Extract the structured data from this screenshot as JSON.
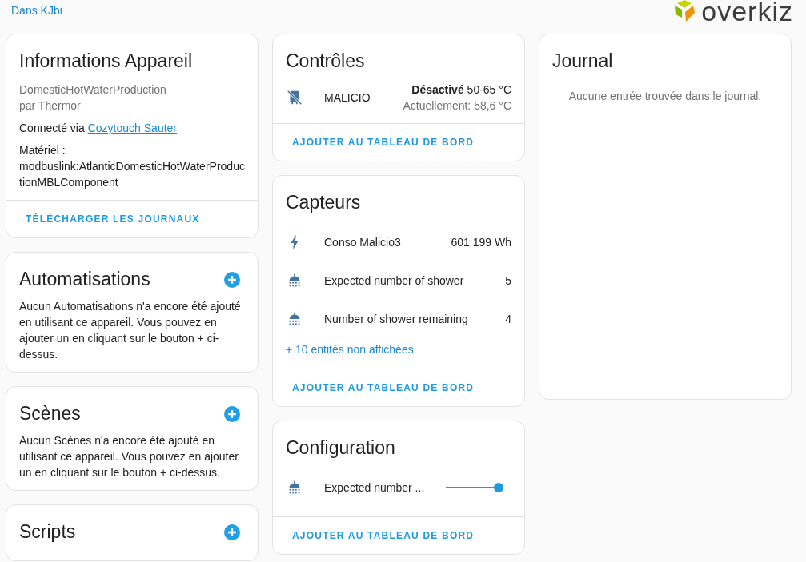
{
  "breadcrumb": "Dans KJbi",
  "logo": {
    "text": "overkiz"
  },
  "info": {
    "title": "Informations Appareil",
    "model": "DomesticHotWaterProduction",
    "manufacturer": "par Thermor",
    "connected_prefix": "Connecté via",
    "connected_link": "Cozytouch Sauter",
    "hardware_label": "Matériel :",
    "hardware_value": "modbuslink:AtlanticDomesticHotWaterProductionMBLComponent",
    "action": "TÉLÉCHARGER LES JOURNAUX"
  },
  "related": [
    {
      "title": "Automatisations",
      "text": "Aucun Automatisations n'a encore été ajouté en utilisant ce appareil. Vous pouvez en ajouter un en cliquant sur le bouton + ci-dessus."
    },
    {
      "title": "Scènes",
      "text": "Aucun Scènes n'a encore été ajouté en utilisant ce appareil. Vous pouvez en ajouter un en cliquant sur le bouton + ci-dessus."
    },
    {
      "title": "Scripts"
    }
  ],
  "controls": {
    "title": "Contrôles",
    "rows": [
      {
        "kind": "heater",
        "name": "MALICIO",
        "state": "Désactivé",
        "range": "50-65 °C",
        "current": "Actuellement: 58,6 °C"
      }
    ],
    "action": "AJOUTER AU TABLEAU DE BORD"
  },
  "sensors": {
    "title": "Capteurs",
    "rows": [
      {
        "kind": "bolt",
        "name": "Conso Malicio3",
        "value": "601 199 Wh"
      },
      {
        "kind": "shower",
        "name": "Expected number of shower",
        "value": "5"
      },
      {
        "kind": "shower",
        "name": "Number of shower remaining",
        "value": "4"
      }
    ],
    "more": "+ 10 entités non affichées",
    "action": "AJOUTER AU TABLEAU DE BORD"
  },
  "configuration": {
    "title": "Configuration",
    "rows": [
      {
        "kind": "shower",
        "name": "Expected number ...",
        "level": 1
      }
    ],
    "action": "AJOUTER AU TABLEAU DE BORD"
  },
  "journal": {
    "title": "Journal",
    "empty": "Aucune entrée trouvée dans le journal."
  }
}
